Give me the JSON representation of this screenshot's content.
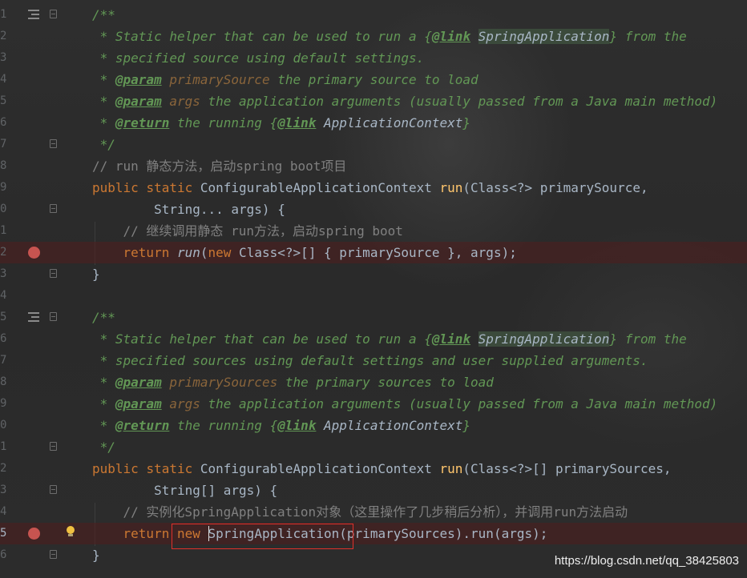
{
  "line_numbers": [
    "1",
    "2",
    "3",
    "4",
    "5",
    "6",
    "7",
    "8",
    "9",
    "0",
    "1",
    "2",
    "3",
    "4",
    "5",
    "6",
    "7",
    "8",
    "9",
    "0",
    "1",
    "2",
    "3",
    "4",
    "5",
    "6"
  ],
  "doc1": {
    "open": "/**",
    "l1_pre": " * Static helper that can be used to run a ",
    "l1_brace": "{",
    "l1_tag": "@link",
    "l1_link": "SpringApplication",
    "l1_close": "}",
    "l1_post": " from the",
    "l2": " * specified source using default settings.",
    "l3_star": " * ",
    "l3_tag": "@param",
    "l3_name": "primarySource",
    "l3_rest": " the primary source to load",
    "l4_star": " * ",
    "l4_tag": "@param",
    "l4_name": "args",
    "l4_rest": " the application arguments (usually passed from a Java main method)",
    "l5_star": " * ",
    "l5_tag": "@return",
    "l5_mid": " the running ",
    "l5_brace": "{",
    "l5_tag2": "@link",
    "l5_sp": " ",
    "l5_link": "ApplicationContext",
    "l5_close": "}",
    "end": " */"
  },
  "line_comment1": "// run 静态方法，启动spring boot项目",
  "method1": {
    "kw1": "public",
    "kw2": "static",
    "type": "ConfigurableApplicationContext",
    "name": "run",
    "params": "(Class<?> primarySource,",
    "cont": "        String... args) {",
    "comment": "    // 继续调用静态 run方法，启动spring boot",
    "ret_ws": "    ",
    "ret_kw": "return",
    "ret_call": "run",
    "ret_open": "(",
    "ret_new": "new",
    "ret_rest": " Class<?>[] { primarySource }, args);",
    "close": "}"
  },
  "doc2": {
    "open": "/**",
    "l1_pre": " * Static helper that can be used to run a ",
    "l1_brace": "{",
    "l1_tag": "@link",
    "l1_link": "SpringApplication",
    "l1_close": "}",
    "l1_post": " from the",
    "l2": " * specified sources using default settings and user supplied arguments.",
    "l3_star": " * ",
    "l3_tag": "@param",
    "l3_name": "primarySources",
    "l3_rest": " the primary sources to load",
    "l4_star": " * ",
    "l4_tag": "@param",
    "l4_name": "args",
    "l4_rest": " the application arguments (usually passed from a Java main method)",
    "l5_star": " * ",
    "l5_tag": "@return",
    "l5_mid": " the running ",
    "l5_brace": "{",
    "l5_tag2": "@link",
    "l5_sp": " ",
    "l5_link": "ApplicationContext",
    "l5_close": "}",
    "end": " */"
  },
  "method2": {
    "kw1": "public",
    "kw2": "static",
    "type": "ConfigurableApplicationContext",
    "name": "run",
    "params": "(Class<?>[] primarySources,",
    "cont": "        String[] args) {",
    "comment": "    // 实例化SpringApplication对象（这里操作了几步稍后分析），并调用run方法启动",
    "ret_ws": "    ",
    "ret_kw": "return",
    "ret_new": "new",
    "ret_class": "SpringApplication",
    "ret_rest": "(primarySources).run(args);",
    "close": "}"
  },
  "watermark": "https://blog.csdn.net/qq_38425803",
  "colors": {
    "background": "#2b2b2b",
    "keyword": "#cc7832",
    "method": "#ffc66d",
    "doc_comment": "#629755",
    "line_comment": "#808080",
    "breakpoint": "#c75450",
    "highlight_box": "#e0312b"
  },
  "icons": [
    "doc-comment-icon",
    "fold-icon",
    "breakpoint-icon",
    "intention-bulb-icon"
  ]
}
